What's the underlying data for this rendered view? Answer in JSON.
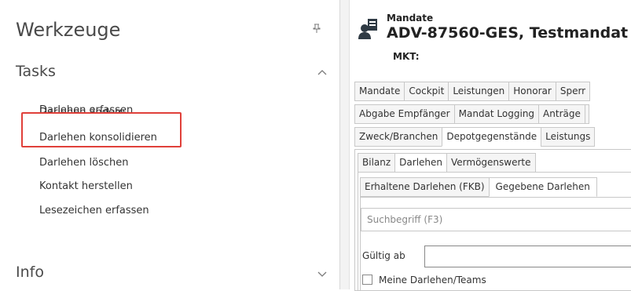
{
  "left_pane": {
    "title": "Werkzeuge",
    "pin_icon": "pin-icon",
    "tasks_section": {
      "label": "Tasks",
      "collapse_icon": "chevron-up-icon",
      "items": [
        "Darlehen erfassen",
        "Darlehen ändern",
        "Darlehen konsolidieren",
        "Darlehen löschen",
        "Kontakt herstellen",
        "Lesezeichen erfassen"
      ]
    },
    "info_section": {
      "label": "Info",
      "expand_icon": "chevron-down-icon"
    },
    "highlight_color": "#e0403a"
  },
  "right_pane": {
    "header": {
      "category": "Mandate",
      "title": "ADV-87560-GES, Testmandat",
      "subtitle": "MKT:"
    },
    "tab_rows": [
      [
        "Mandate",
        "Cockpit",
        "Leistungen",
        "Honorar",
        "Sperr"
      ],
      [
        "Abgabe Empfänger",
        "Mandat Logging",
        "Anträge"
      ],
      [
        "Zweck/Branchen",
        "Depotgegenstände",
        "Leistungs"
      ]
    ],
    "subtabs": {
      "items": [
        "Bilanz",
        "Darlehen",
        "Vermögenswerte"
      ],
      "active": "Darlehen"
    },
    "loan_tabs": {
      "items": [
        "Erhaltene Darlehen (FKB)",
        "Gegebene Darlehen"
      ],
      "active": "Gegebene Darlehen"
    },
    "search": {
      "placeholder": "Suchbegriff (F3)"
    },
    "gueltig_ab": {
      "label": "Gültig ab",
      "value": ""
    },
    "meine_darlehen": {
      "label": "Meine Darlehen/Teams",
      "checked": false
    }
  },
  "accent_color": "#2b78c5"
}
